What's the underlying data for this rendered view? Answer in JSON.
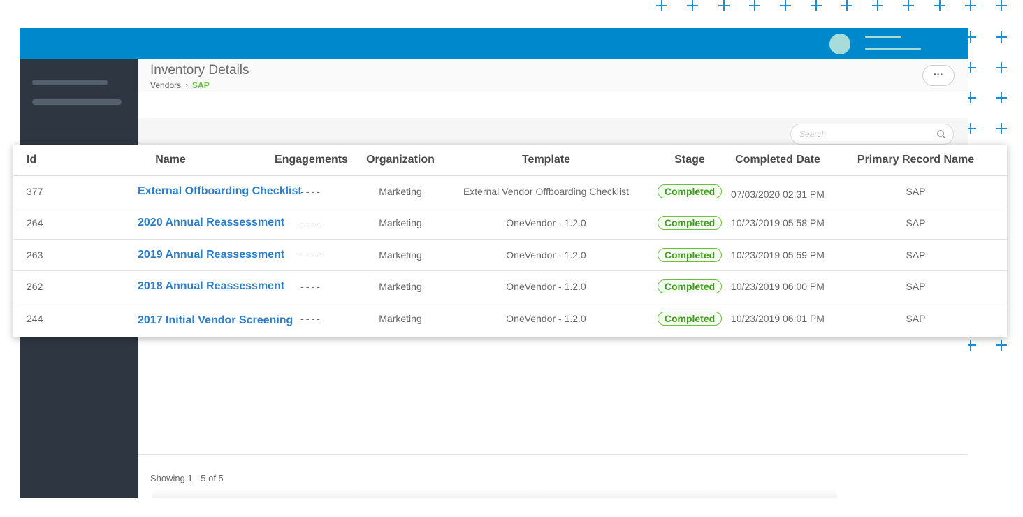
{
  "header": {
    "title": "Inventory Details",
    "breadcrumb": [
      "Vendors",
      "SAP"
    ],
    "more_label": "···"
  },
  "search": {
    "placeholder": "Search"
  },
  "table": {
    "columns": [
      "Id",
      "Name",
      "Engagements",
      "Organization",
      "Template",
      "Stage",
      "Completed Date",
      "Primary Record Name"
    ],
    "rows": [
      {
        "id": "377",
        "name": "External Offboarding Checklist",
        "engagements": "----",
        "organization": "Marketing",
        "template": "External Vendor Offboarding Checklist",
        "stage": "Completed",
        "completed_date": "07/03/2020 02:31 PM",
        "primary_record": "SAP"
      },
      {
        "id": "264",
        "name": "2020 Annual Reassessment",
        "engagements": "----",
        "organization": "Marketing",
        "template": "OneVendor - 1.2.0",
        "stage": "Completed",
        "completed_date": "10/23/2019 05:58 PM",
        "primary_record": "SAP"
      },
      {
        "id": "263",
        "name": "2019 Annual Reassessment",
        "engagements": "----",
        "organization": "Marketing",
        "template": "OneVendor - 1.2.0",
        "stage": "Completed",
        "completed_date": "10/23/2019 05:59 PM",
        "primary_record": "SAP"
      },
      {
        "id": "262",
        "name": "2018 Annual Reassessment",
        "engagements": "----",
        "organization": "Marketing",
        "template": "OneVendor - 1.2.0",
        "stage": "Completed",
        "completed_date": "10/23/2019 06:00 PM",
        "primary_record": "SAP"
      },
      {
        "id": "244",
        "name": "2017 Initial Vendor Screening",
        "engagements": "----",
        "organization": "Marketing",
        "template": "OneVendor - 1.2.0",
        "stage": "Completed",
        "completed_date": "10/23/2019 06:01 PM",
        "primary_record": "SAP"
      }
    ]
  },
  "footer": {
    "showing": "Showing 1 - 5 of 5"
  },
  "colors": {
    "topbar": "#0088cc",
    "sidebar": "#2e3642",
    "link": "#2e7dc7",
    "stage_green": "#6abf40",
    "decor_plus": "#1a8fd6"
  },
  "icons": {
    "search": "search-icon",
    "more": "more-dots-icon",
    "decor": "plus-icon"
  }
}
